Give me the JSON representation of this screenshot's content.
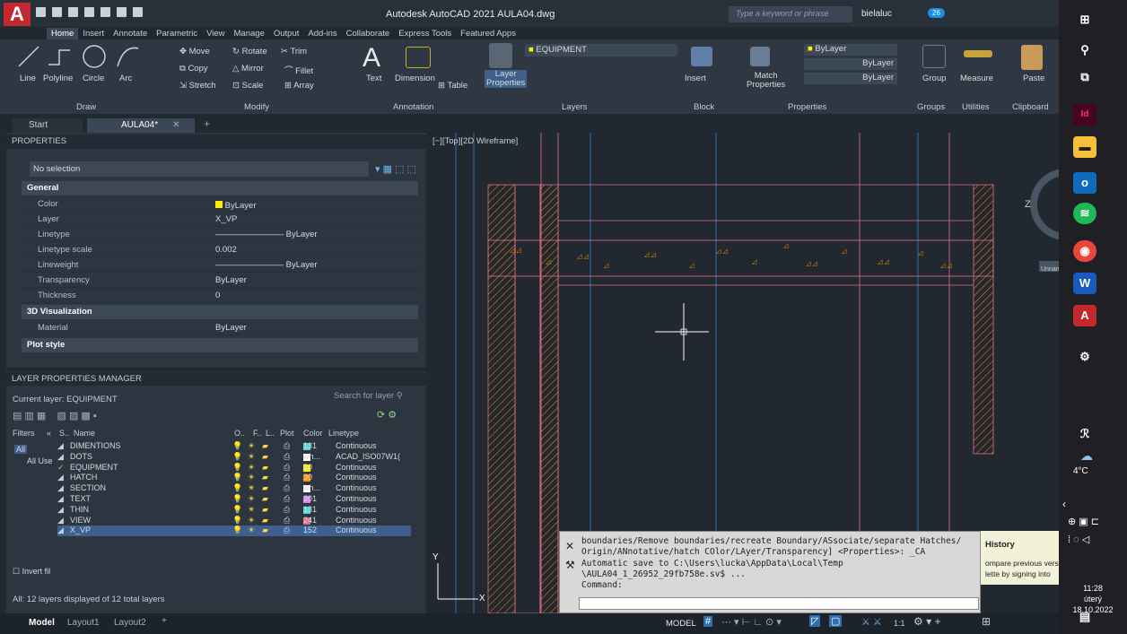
{
  "window": {
    "title": "Autodesk AutoCAD 2021  AULA04.dwg",
    "search_placeholder": "Type a keyword or phrase",
    "user": "bielaluc",
    "notif_count": "26"
  },
  "ribbon_tabs": [
    "Home",
    "Insert",
    "Annotate",
    "Parametric",
    "View",
    "Manage",
    "Output",
    "Add-ins",
    "Collaborate",
    "Express Tools",
    "Featured Apps"
  ],
  "draw": {
    "title": "Draw",
    "line": "Line",
    "polyline": "Polyline",
    "circle": "Circle",
    "arc": "Arc"
  },
  "modify": {
    "title": "Modify",
    "move": "Move",
    "rotate": "Rotate",
    "trim": "Trim",
    "copy": "Copy",
    "mirror": "Mirror",
    "fillet": "Fillet",
    "stretch": "Stretch",
    "scale": "Scale",
    "array": "Array"
  },
  "annotation": {
    "title": "Annotation",
    "text": "Text",
    "dimension": "Dimension",
    "table": "Table"
  },
  "layers": {
    "title": "Layers",
    "layer_props": "Layer",
    "layer_props2": "Properties",
    "current": "EQUIPMENT"
  },
  "block": {
    "title": "Block",
    "insert": "Insert"
  },
  "properties_panel": {
    "title": "Properties",
    "match": "Match",
    "match2": "Properties",
    "color": "ByLayer",
    "lineweight": "ByLayer",
    "linetype": "ByLayer"
  },
  "groups": {
    "title": "Groups",
    "group": "Group"
  },
  "utilities": {
    "title": "Utilities",
    "measure": "Measure"
  },
  "clipboard": {
    "title": "Clipboard",
    "paste": "Paste"
  },
  "doc_tabs": {
    "start": "Start",
    "file": "AULA04*"
  },
  "properties": {
    "header": "PROPERTIES",
    "selection": "No selection",
    "general_title": "General",
    "rows": [
      {
        "k": "Color",
        "v": "ByLayer"
      },
      {
        "k": "Layer",
        "v": "X_VP"
      },
      {
        "k": "Linetype",
        "v": "ByLayer"
      },
      {
        "k": "Linetype scale",
        "v": "0.002"
      },
      {
        "k": "Lineweight",
        "v": "ByLayer"
      },
      {
        "k": "Transparency",
        "v": "ByLayer"
      },
      {
        "k": "Thickness",
        "v": "0"
      }
    ],
    "viz_title": "3D Visualization",
    "material_k": "Material",
    "material_v": "ByLayer",
    "plot_title": "Plot style"
  },
  "lpm": {
    "header": "LAYER PROPERTIES MANAGER",
    "current_layer": "Current layer: EQUIPMENT",
    "search": "Search for layer",
    "filters": "Filters",
    "all": "All",
    "all_used": "All Use",
    "invert": "Invert fil",
    "col_s": "S..",
    "col_name": "Name",
    "col_on": "O..",
    "col_f": "F..",
    "col_l": "L..",
    "col_plot": "Plot",
    "col_color": "Color",
    "col_linetype": "Linetype",
    "layers": [
      {
        "name": "DIMENTIONS",
        "color": "131",
        "hex": "#5bd6d6",
        "lt": "Continuous"
      },
      {
        "name": "DOTS",
        "color": "wh...",
        "hex": "#ffffff",
        "lt": "ACAD_ISO07W1("
      },
      {
        "name": "EQUIPMENT",
        "color": "50",
        "hex": "#ffee00",
        "lt": "Continuous"
      },
      {
        "name": "HATCH",
        "color": "30",
        "hex": "#ff8a00",
        "lt": "Continuous"
      },
      {
        "name": "SECTION",
        "color": "wh...",
        "hex": "#ffffff",
        "lt": "Continuous"
      },
      {
        "name": "TEXT",
        "color": "201",
        "hex": "#e07fe0",
        "lt": "Continuous"
      },
      {
        "name": "THIN",
        "color": "131",
        "hex": "#5bd6d6",
        "lt": "Continuous"
      },
      {
        "name": "VIEW",
        "color": "241",
        "hex": "#e0708a",
        "lt": "Continuous"
      },
      {
        "name": "X_VP",
        "color": "152",
        "hex": "#2f6fb0",
        "lt": "Continuous"
      }
    ],
    "status": "All: 12 layers displayed of 12 total layers"
  },
  "bottom_tabs": [
    "Model",
    "Layout1",
    "Layout2"
  ],
  "viewport_label": "[−][Top][2D Wireframe]",
  "command": {
    "lines": "boundaries/Remove boundaries/recreate Boundary/ASsociate/separate Hatches/\nOrigin/ANnotative/hatch COlor/LAyer/Transparency] <Properties>: _CA\nAutomatic save to C:\\Users\\lucka\\AppData\\Local\\Temp\n\\AULA04_1_26952_29fb758e.sv$ ...\nCommand:",
    "history_title": "History",
    "history_text1": "ompare previous vers",
    "history_text2": "lette by signing into"
  },
  "status_bar": {
    "model": "MODEL",
    "scale": "1:1"
  },
  "viewcube_label": "Unnan",
  "taskbar": {
    "temp": "4°C",
    "time": "11:28",
    "day": "úterý",
    "date": "18.10.2022"
  }
}
